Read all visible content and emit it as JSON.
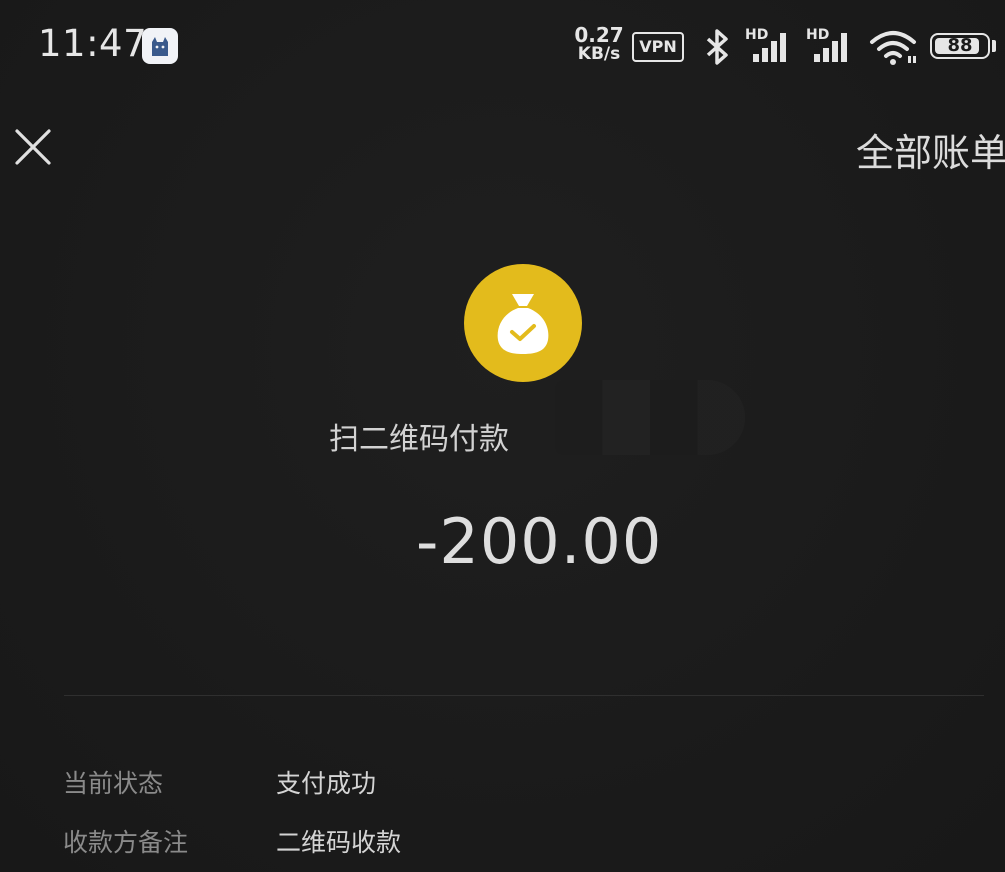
{
  "status_bar": {
    "time": "11:47",
    "net_speed_value": "0.27",
    "net_speed_unit": "KB/s",
    "vpn": "VPN",
    "signal_1_label": "HD",
    "signal_2_label": "HD",
    "battery_level": "88",
    "icons": [
      "cat-app-icon",
      "bluetooth-icon",
      "signal-icon",
      "signal-icon",
      "wifi-icon",
      "battery-icon"
    ]
  },
  "header": {
    "close_icon": "close-icon",
    "all_bills": "全部账单"
  },
  "transaction": {
    "logo_icon": "money-bag-check-icon",
    "logo_color": "#e3bb1c",
    "merchant": "扫二维码付款",
    "amount": "-200.00"
  },
  "details": [
    {
      "label": "当前状态",
      "value": "支付成功"
    },
    {
      "label": "收款方备注",
      "value": "二维码收款"
    }
  ]
}
